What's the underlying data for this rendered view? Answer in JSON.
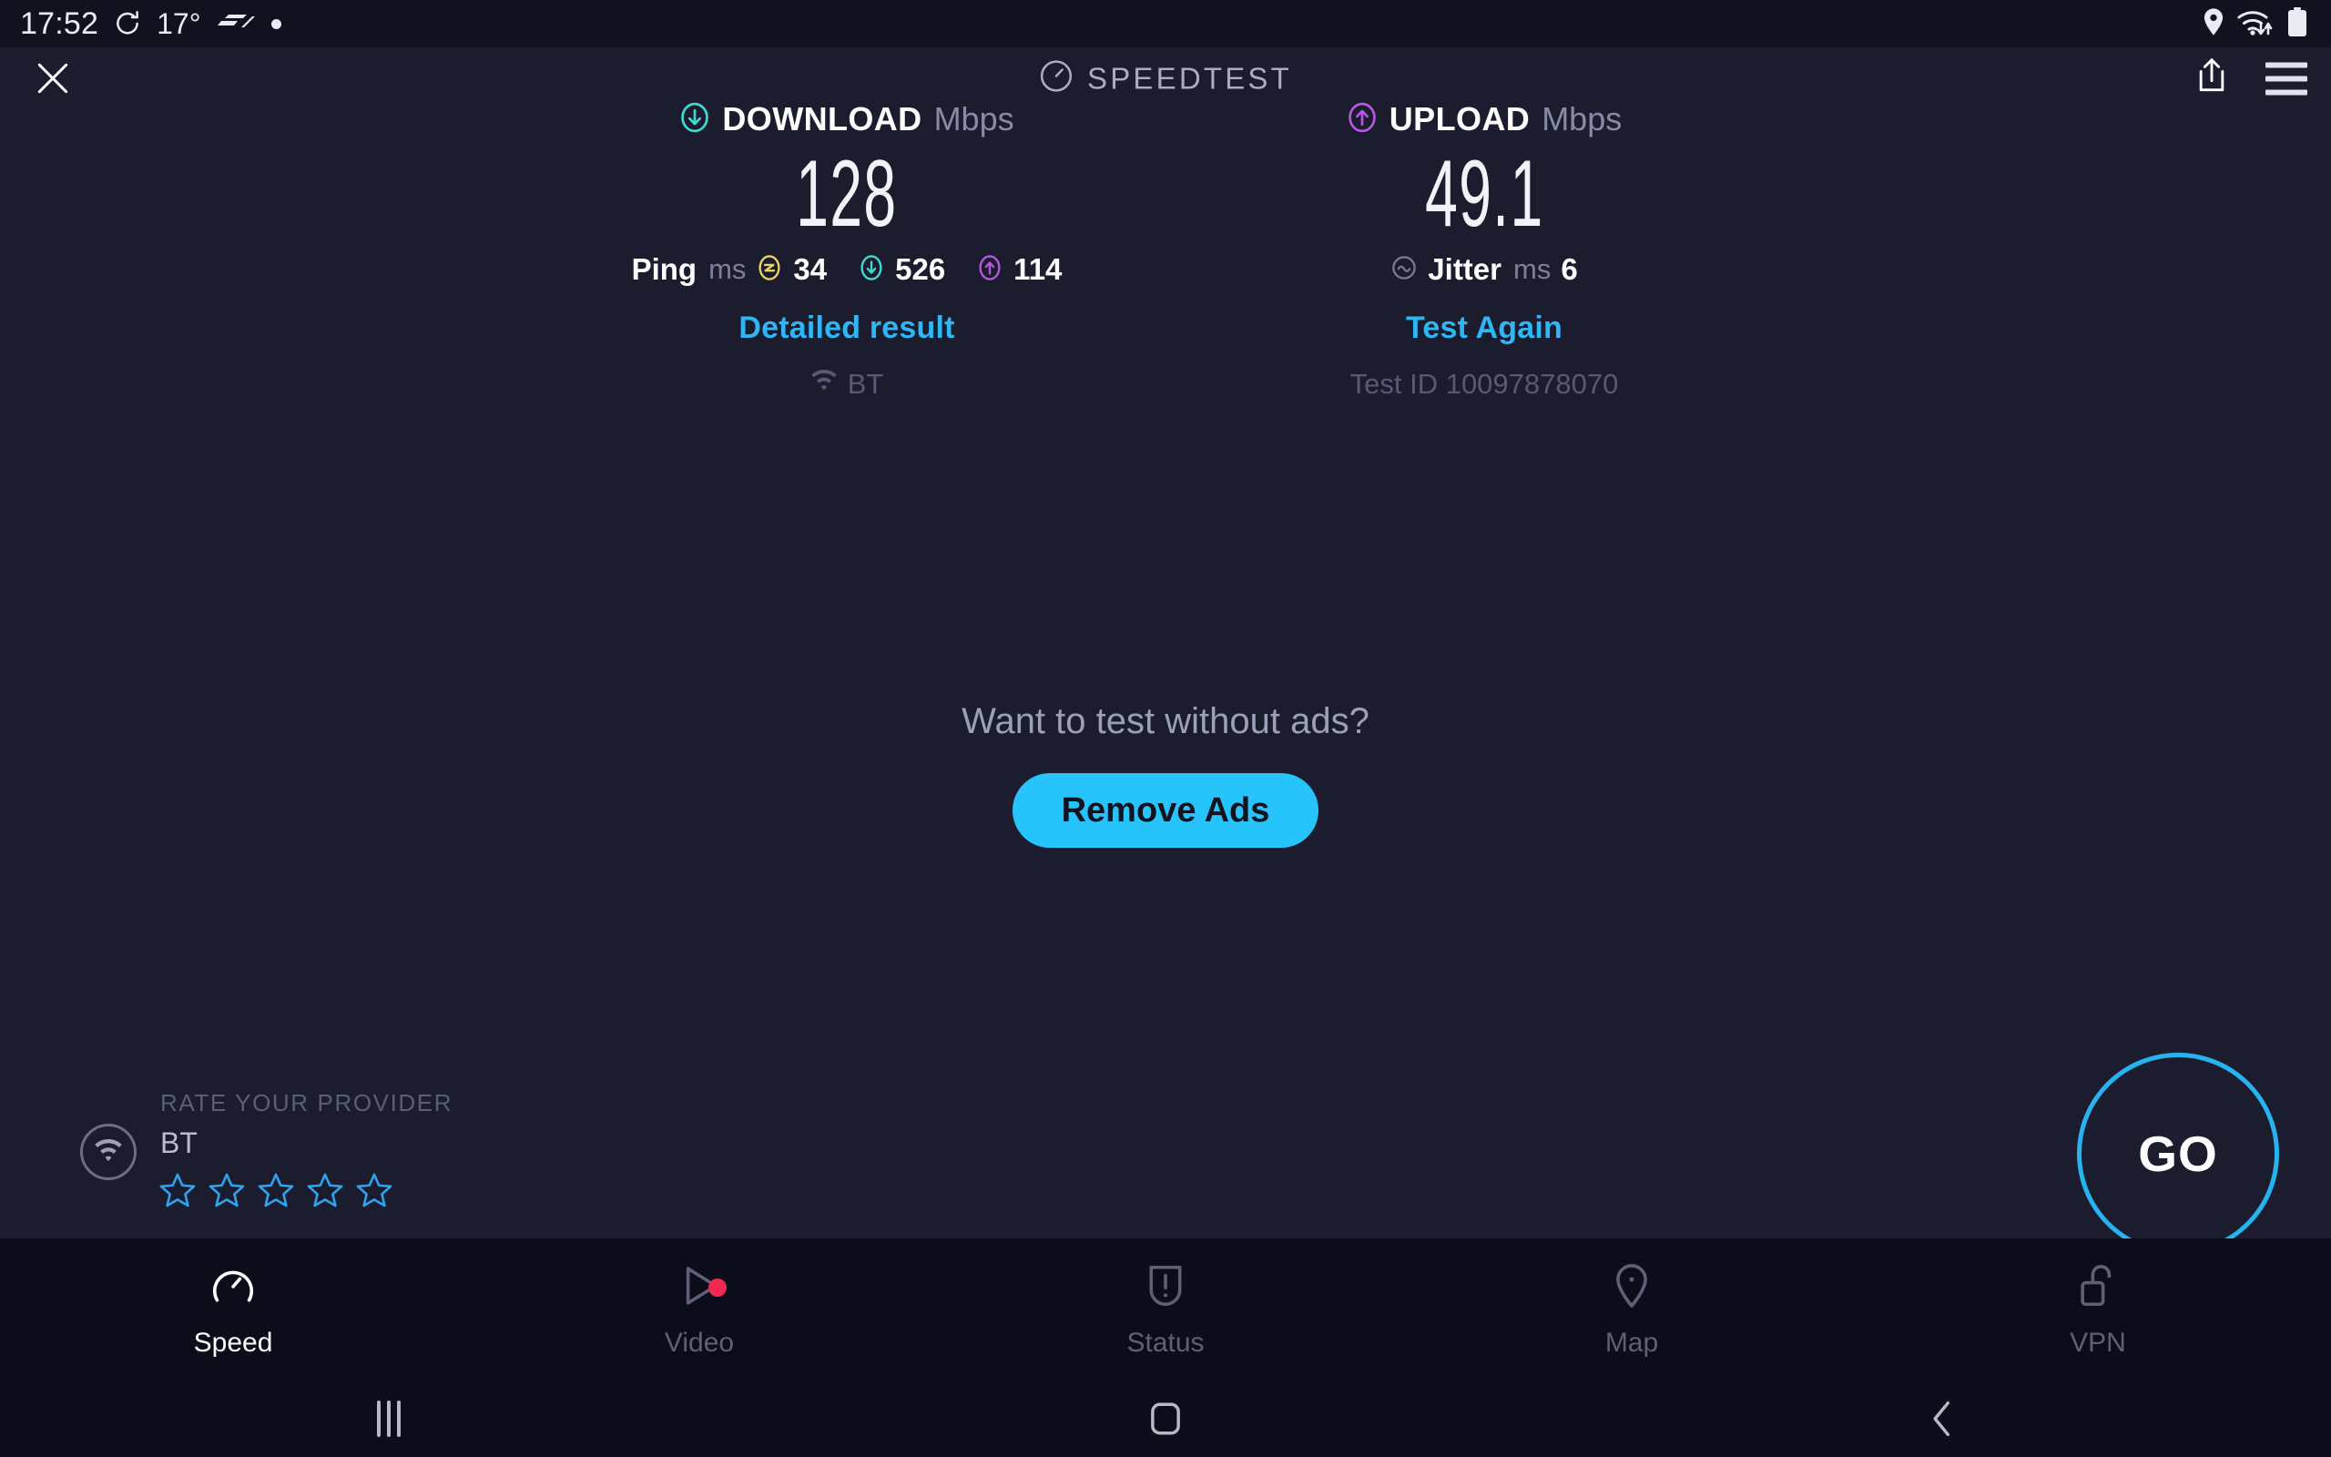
{
  "status_bar": {
    "time": "17:52",
    "temperature": "17°",
    "icons_left": [
      "refresh-icon",
      "f1-logo-icon",
      "dot-indicator-icon"
    ],
    "icons_right": [
      "location-icon",
      "wifi-transfer-icon",
      "battery-icon"
    ]
  },
  "header": {
    "close_icon": "close-icon",
    "brand": "SPEEDTEST",
    "brand_icon": "speedometer-icon",
    "share_icon": "share-icon",
    "menu_icon": "hamburger-menu-icon"
  },
  "results": {
    "download": {
      "label": "DOWNLOAD",
      "unit": "Mbps",
      "value": "128",
      "icon": "download-arrow-icon",
      "color": "#3ddcd0"
    },
    "upload": {
      "label": "UPLOAD",
      "unit": "Mbps",
      "value": "49.1",
      "icon": "upload-arrow-icon",
      "color": "#b557e0"
    },
    "ping": {
      "label": "Ping",
      "unit": "ms",
      "idle": {
        "icon": "idle-latency-icon",
        "value": "34",
        "color": "#e9d264"
      },
      "download": {
        "icon": "download-latency-icon",
        "value": "526",
        "color": "#3ddcd0"
      },
      "upload": {
        "icon": "upload-latency-icon",
        "value": "114",
        "color": "#b557e0"
      }
    },
    "jitter": {
      "label": "Jitter",
      "unit": "ms",
      "value": "6",
      "icon": "jitter-wave-icon"
    },
    "detailed_result_link": "Detailed result",
    "test_again_link": "Test Again",
    "connection": {
      "icon": "wifi-icon",
      "name": "BT"
    },
    "test_id": "Test ID 10097878070"
  },
  "promo": {
    "question": "Want to test without ads?",
    "button": "Remove Ads",
    "button_color": "#27c3fb"
  },
  "rate_provider": {
    "title": "RATE YOUR PROVIDER",
    "provider": "BT",
    "icon": "wifi-circle-icon",
    "stars": [
      {
        "index": 1,
        "filled": false
      },
      {
        "index": 2,
        "filled": false
      },
      {
        "index": 3,
        "filled": false
      },
      {
        "index": 4,
        "filled": false
      },
      {
        "index": 5,
        "filled": false
      }
    ],
    "star_color": "#2ea3ef"
  },
  "go_button": {
    "label": "GO",
    "color": "#27b2f0"
  },
  "tabs": [
    {
      "label": "Speed",
      "icon": "speedometer-icon",
      "active": true,
      "badge": false
    },
    {
      "label": "Video",
      "icon": "play-triangle-icon",
      "active": false,
      "badge": true
    },
    {
      "label": "Status",
      "icon": "alert-drop-icon",
      "active": false,
      "badge": false
    },
    {
      "label": "Map",
      "icon": "map-pin-icon",
      "active": false,
      "badge": false
    },
    {
      "label": "VPN",
      "icon": "unlocked-padlock-icon",
      "active": false,
      "badge": false
    }
  ],
  "android_nav": {
    "recents": "recents-icon",
    "home": "home-icon",
    "back": "back-icon"
  },
  "theme": {
    "background": "#1b1c2e",
    "bar_background": "#0b0d1a",
    "link": "#2eb6f5"
  }
}
